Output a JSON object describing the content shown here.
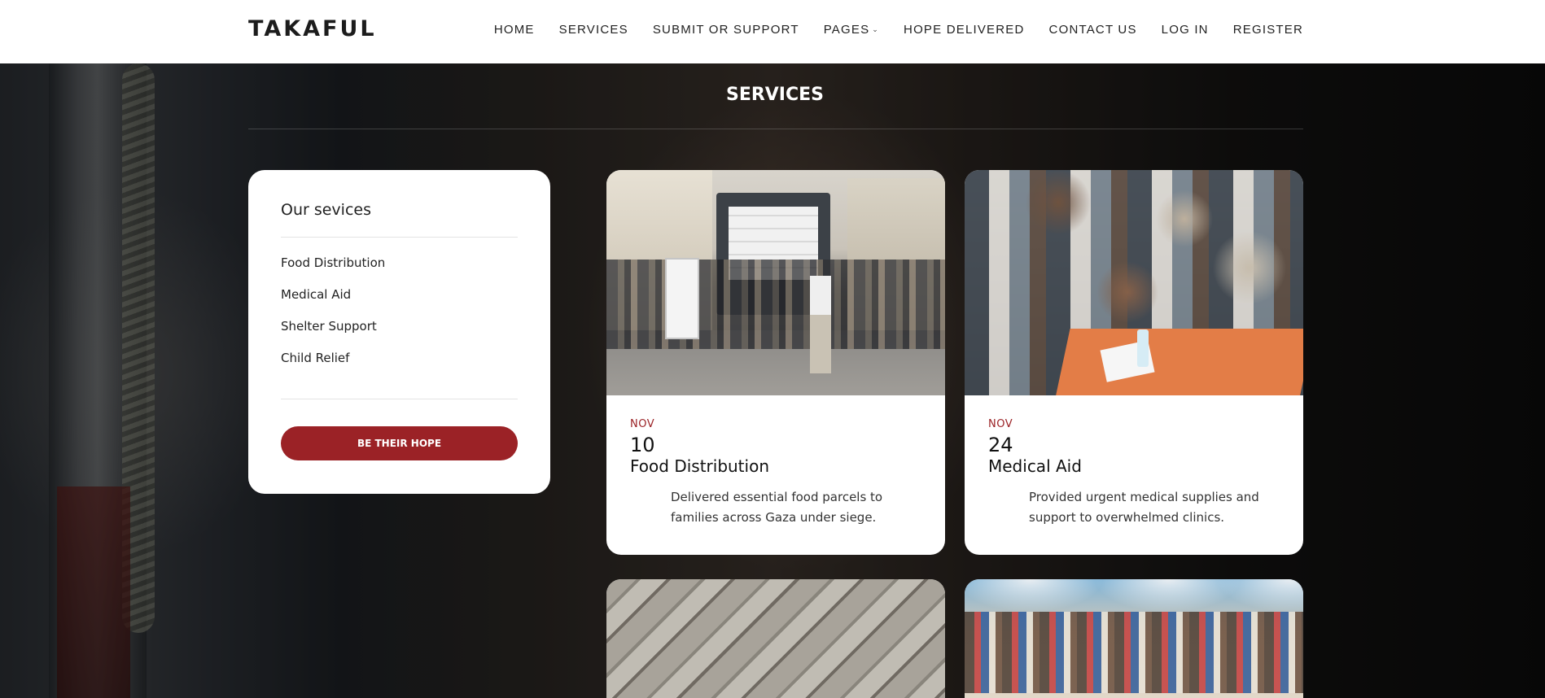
{
  "header": {
    "logo": "TAKAFUL",
    "nav": [
      {
        "label": "HOME"
      },
      {
        "label": "SERVICES"
      },
      {
        "label": "SUBMIT OR SUPPORT"
      },
      {
        "label": "PAGES",
        "has_dropdown": true
      },
      {
        "label": "HOPE DELIVERED"
      },
      {
        "label": "CONTACT US"
      },
      {
        "label": "LOG IN"
      },
      {
        "label": "REGISTER"
      }
    ]
  },
  "page": {
    "title": "SERVICES"
  },
  "sidebar": {
    "title": "Our sevices",
    "items": [
      {
        "label": "Food Distribution"
      },
      {
        "label": "Medical Aid"
      },
      {
        "label": "Shelter Support"
      },
      {
        "label": "Child Relief"
      }
    ],
    "button_label": "BE THEIR HOPE"
  },
  "cards": [
    {
      "month": "NOV",
      "day": "10",
      "title": "Food Distribution",
      "description": "Delivered essential food parcels to families across Gaza under siege."
    },
    {
      "month": "NOV",
      "day": "24",
      "title": "Medical Aid",
      "description": "Provided urgent medical supplies and support to overwhelmed clinics."
    }
  ],
  "colors": {
    "accent": "#9b2226",
    "header_bg": "#ffffff",
    "card_bg": "#ffffff"
  }
}
